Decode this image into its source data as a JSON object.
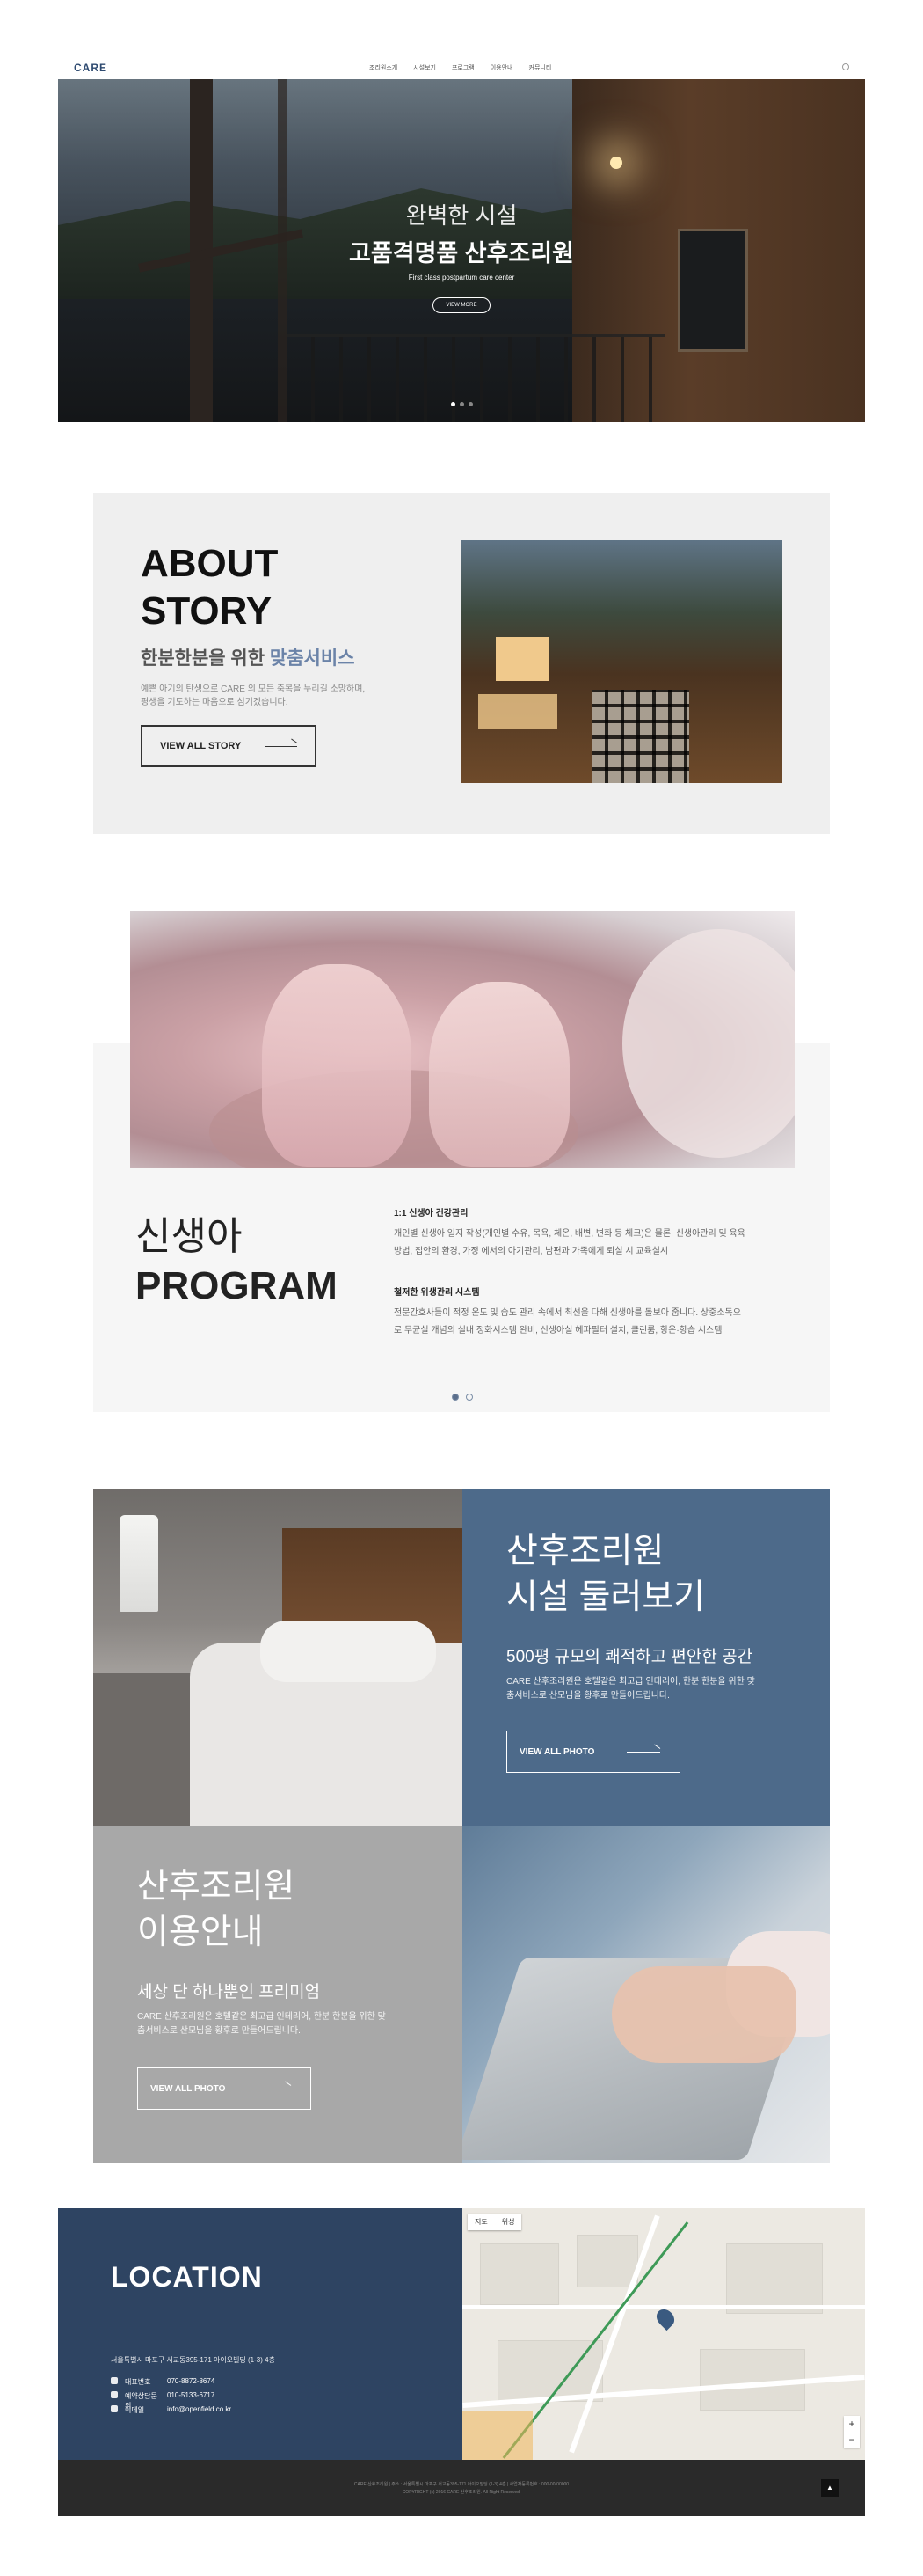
{
  "header": {
    "logo": "CARE",
    "nav": [
      "조리원소개",
      "시설보기",
      "프로그램",
      "이용안내",
      "커뮤니티"
    ]
  },
  "hero": {
    "subtitle": "완벽한 시설",
    "title": "고품격명품 산후조리원",
    "english": "First class postpartum care center",
    "button": "VIEW MORE"
  },
  "about": {
    "title_line1": "ABOUT",
    "title_line2": "STORY",
    "subtitle_plain": "한분한분을 위한",
    "subtitle_highlight": "맞춤서비스",
    "desc_line1": "예쁜 아기의 탄생으로 CARE 의 모든 축복을 누리길 소망하며,",
    "desc_line2": "평생을 기도하는 마음으로 섬기겠습니다.",
    "button": "VIEW ALL STORY"
  },
  "program": {
    "title_line1": "신생아",
    "title_line2": "PROGRAM",
    "block1_title": "1:1 신생아 건강관리",
    "block1_line1": "개인별 신생아 일지 작성(개인별 수유, 목욕, 체온, 배변, 변화 등 체크)은 물론, 신생아관리 및 육육",
    "block1_line2": "방법, 집안의 환경, 가정 에서의 아기관리, 남편과 가족에게 퇴실 시 교육실시",
    "block2_title": "철저한 위생관리 시스템",
    "block2_line1": "전문간호사들이 적정 온도 및 습도 관리 속에서 최선을 다해 신생아를 돌보아 줍니다. 상중소독으",
    "block2_line2": "로 무균실 개념의 실내 정화시스템 완비, 신생아실 헤파필터 설치, 클린룸, 항온·항습 시스템"
  },
  "facility": {
    "title_line1": "산후조리원",
    "title_line2": "시설 둘러보기",
    "subtitle": "500평 규모의 쾌적하고 편안한 공간",
    "desc_line1": "CARE 산후조리원은 호텔같은 최고급 인테리어, 한분 한분을 위한 맞",
    "desc_line2": "춤서비스로 산모님을 황후로 만들어드립니다.",
    "button": "VIEW ALL PHOTO"
  },
  "guide": {
    "title_line1": "산후조리원",
    "title_line2": "이용안내",
    "subtitle": "세상 단 하나뿐인 프리미엄",
    "desc_line1": "CARE 산후조리원은 호텔같은 최고급 인테리어, 한분 한분을 위한 맞",
    "desc_line2": "춤서비스로 산모님을 황후로 만들어드립니다.",
    "button": "VIEW ALL PHOTO"
  },
  "location": {
    "title": "LOCATION",
    "address": "서울특별시 마포구 서교동395-171 아이오빌딩 (1-3) 4층",
    "rows": [
      {
        "label": "대표번호",
        "value": "070-8872-8674"
      },
      {
        "label": "예약상담문의",
        "value": "010-5133-6717"
      },
      {
        "label": "이메일",
        "value": "info@openfield.co.kr"
      }
    ]
  },
  "map": {
    "tab_map": "지도",
    "tab_sat": "위성",
    "zoom_in": "+",
    "zoom_out": "−"
  },
  "footer": {
    "line1": "CARE 산후조리원 | 주소 : 서울특별시 마포구 서교동395-171 아이오빌딩 (1-3) 4층 | 사업자등록번호 : 000-00-00000",
    "line2": "COPYRIGHT (c) 2016 CARE 산후조리원. All Right Reserved.",
    "top_button": "▲"
  }
}
